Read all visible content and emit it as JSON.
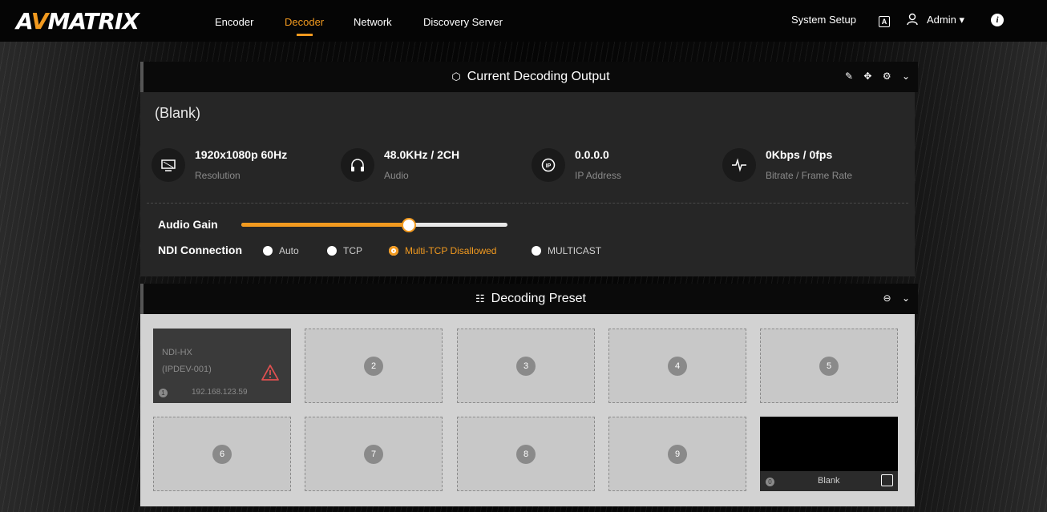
{
  "brand": {
    "logo_a": "A",
    "logo_v": "V",
    "logo_rest": "MATRIX"
  },
  "nav": {
    "encoder": "Encoder",
    "decoder": "Decoder",
    "network": "Network",
    "discovery": "Discovery Server",
    "active": "Decoder"
  },
  "header_right": {
    "system_setup": "System Setup",
    "lang_icon": "A",
    "user": "Admin"
  },
  "output_panel": {
    "title": "Current Decoding Output",
    "source_name": "(Blank)",
    "stats": [
      {
        "value": "1920x1080p 60Hz",
        "label": "Resolution",
        "icon": "monitor-icon"
      },
      {
        "value": "48.0KHz / 2CH",
        "label": "Audio",
        "icon": "headphones-icon"
      },
      {
        "value": "0.0.0.0",
        "label": "IP Address",
        "icon": "ip-icon"
      },
      {
        "value": "0Kbps / 0fps",
        "label": "Bitrate / Frame Rate",
        "icon": "pulse-icon"
      }
    ],
    "audio_gain_label": "Audio Gain",
    "audio_gain_level": 0.63,
    "ndi_label": "NDI Connection",
    "ndi_options": [
      "Auto",
      "TCP",
      "Multi-TCP Disallowed",
      "MULTICAST"
    ],
    "ndi_selected": "Multi-TCP Disallowed"
  },
  "preset_panel": {
    "title": "Decoding Preset",
    "preset_1": {
      "type": "NDI-HX",
      "device": "(IPDEV-001)",
      "ip": "192.168.123.59",
      "number": "1"
    },
    "empty_numbers": [
      "2",
      "3",
      "4",
      "5",
      "6",
      "7",
      "8",
      "9"
    ],
    "blank_tile": {
      "number": "0",
      "label": "Blank"
    }
  },
  "colors": {
    "accent": "#f29a1f",
    "panel": "#262626",
    "preset_bg": "#d2d2d2"
  }
}
